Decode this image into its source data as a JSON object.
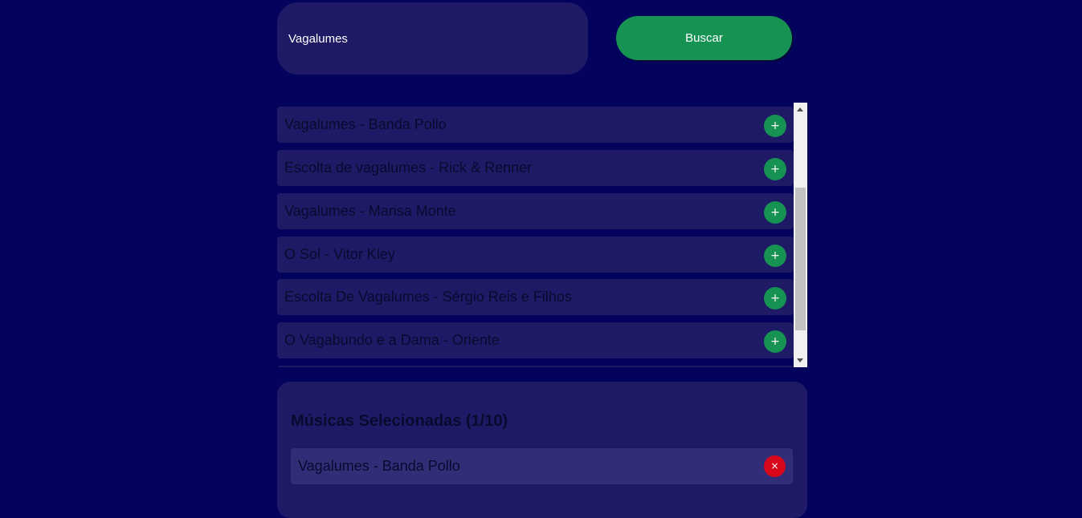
{
  "search": {
    "value": "Vagalumes",
    "button_label": "Buscar"
  },
  "results": [
    {
      "label": "Vagalumes - Banda Pollo",
      "action": "+"
    },
    {
      "label": "Escolta de vagalumes - Rick & Renner",
      "action": "+"
    },
    {
      "label": "Vagalumes - Marisa Monte",
      "action": "+"
    },
    {
      "label": "O Sol - Vitor Kley",
      "action": "+"
    },
    {
      "label": "Escolta De Vagalumes - Sérgio Reis e Filhos",
      "action": "+"
    },
    {
      "label": "O Vagabundo e a Dama - Oriente",
      "action": "+"
    }
  ],
  "selected": {
    "title": "Músicas Selecionadas (1/10)",
    "items": [
      {
        "label": "Vagalumes - Banda Pollo",
        "action": "×"
      }
    ]
  },
  "colors": {
    "background": "#03025c",
    "panel": "#1e1a66",
    "accent_green": "#169352",
    "danger_red": "#d9071b"
  },
  "icons": {
    "add": "plus-icon",
    "remove": "close-icon"
  }
}
